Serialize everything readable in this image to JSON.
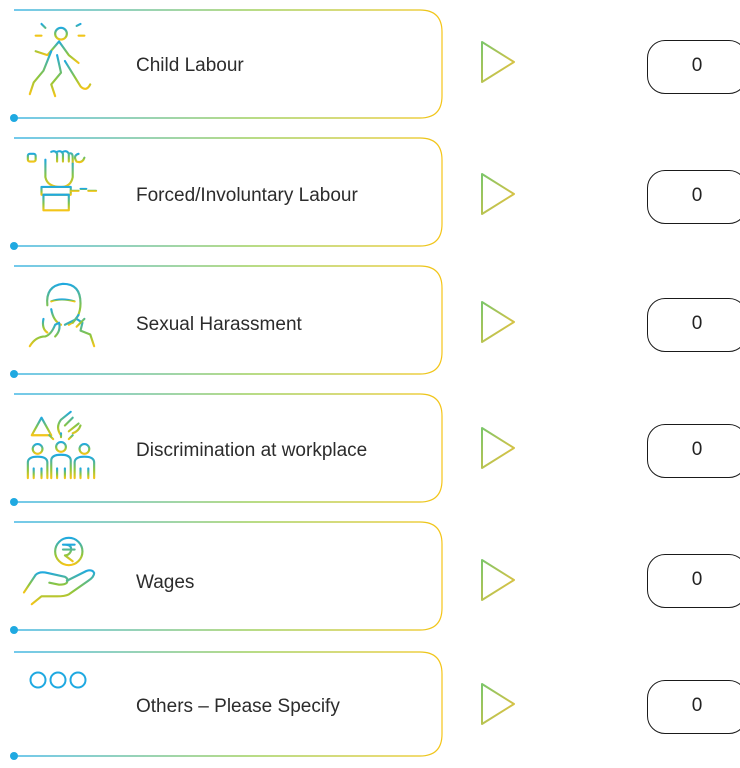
{
  "colors": {
    "gradient_start": "#1fa9e1",
    "gradient_end": "#f5c518",
    "text": "#2c2c2c",
    "box_border": "#1a1a1a"
  },
  "rows": [
    {
      "label": "Child Labour",
      "value": "0",
      "icon": "child-labour-icon"
    },
    {
      "label": "Forced/Involuntary Labour",
      "value": "0",
      "icon": "forced-labour-icon"
    },
    {
      "label": "Sexual Harassment",
      "value": "0",
      "icon": "sexual-harassment-icon"
    },
    {
      "label": "Discrimination at workplace",
      "value": "0",
      "icon": "discrimination-icon"
    },
    {
      "label": "Wages",
      "value": "0",
      "icon": "wages-icon"
    },
    {
      "label": "Others – Please Specify",
      "value": "0",
      "icon": "others-icon"
    }
  ]
}
